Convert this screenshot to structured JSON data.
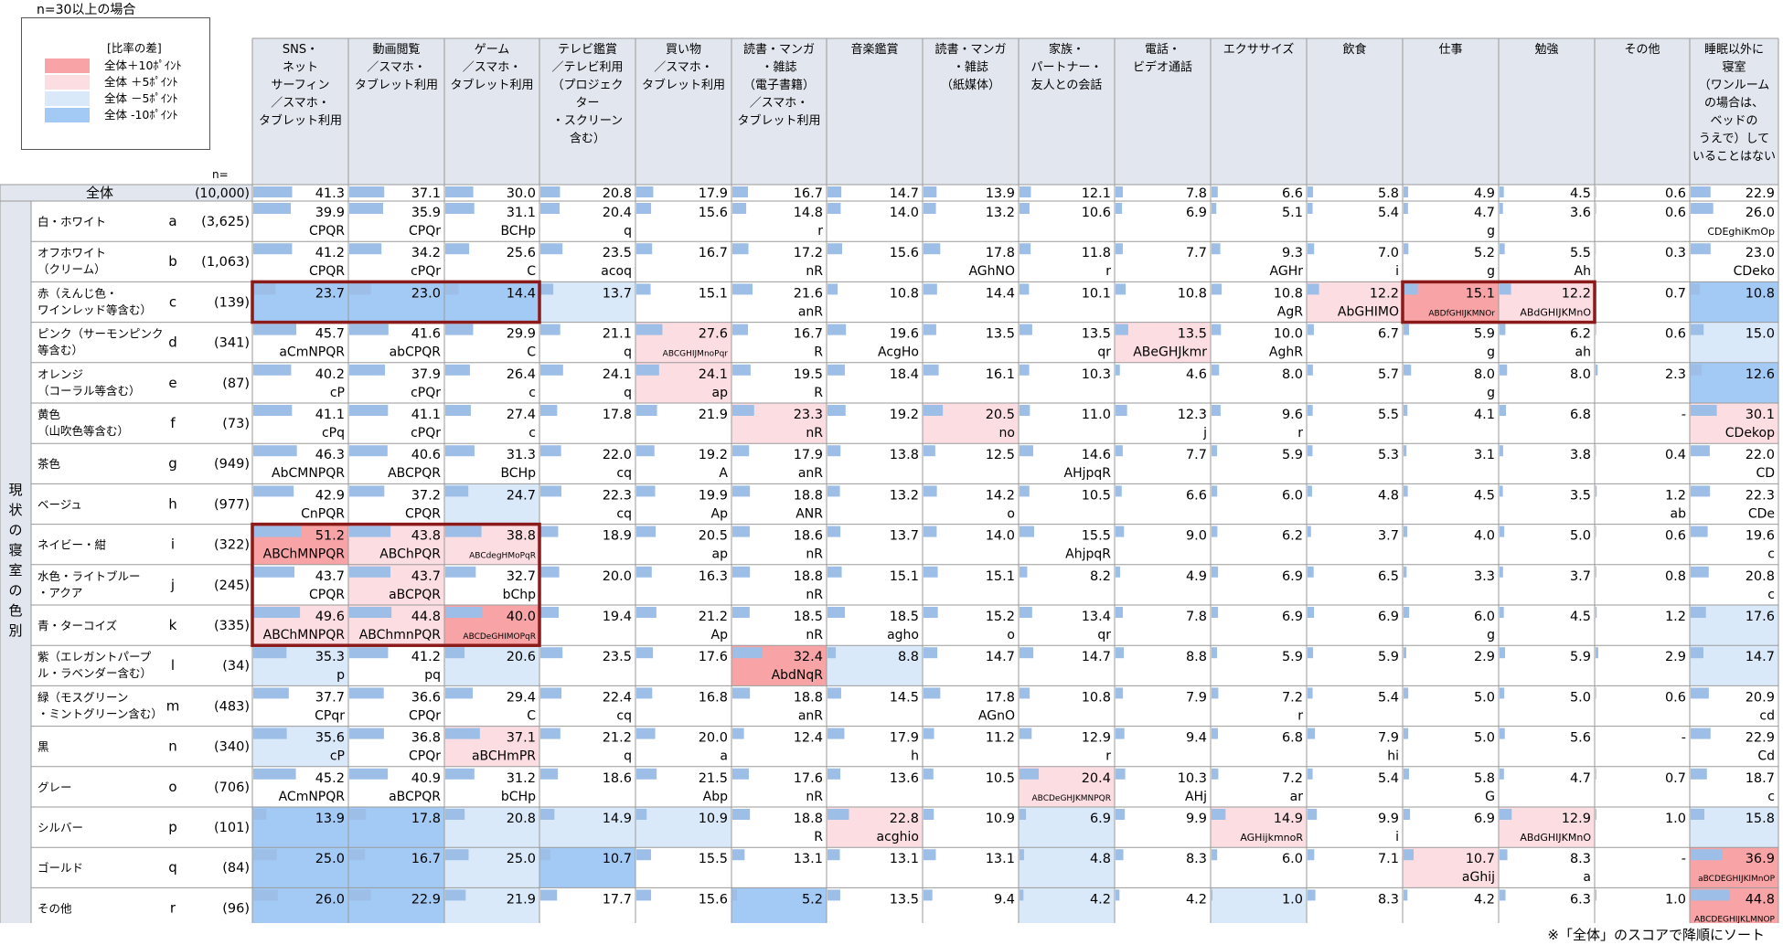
{
  "note": "n=30以上の場合",
  "unit": "(%)",
  "footer": "※「全体」のスコアで降順にソート",
  "n_label": "n=",
  "legend": {
    "title": "[比率の差]",
    "items": [
      {
        "label": "全体＋10ﾎﾟｲﾝﾄ",
        "color": "#F8A4A6"
      },
      {
        "label": "全体 ＋5ﾎﾟｲﾝﾄ",
        "color": "#FCDDE2"
      },
      {
        "label": "全体 －5ﾎﾟｲﾝﾄ",
        "color": "#DAE9FA"
      },
      {
        "label": "全体 -10ﾎﾟｲﾝﾄ",
        "color": "#A3CAF5"
      }
    ]
  },
  "colors": {
    "bar": "#9DBEE6",
    "highlight_box": "#8B1A1A",
    "grid": "#9A9A9A",
    "band": "#E2E6EE"
  },
  "chart_data": {
    "type": "table",
    "columns": [
      "SNS・\nネット\nサーフィン\n／スマホ・\nタブレット利用",
      "動画閲覧\n／スマホ・\nタブレット利用",
      "ゲーム\n／スマホ・\nタブレット利用",
      "テレビ鑑賞\n／テレビ利用\n（プロジェク\nター\n・スクリーン\n含む）",
      "買い物\n／スマホ・\nタブレット利用",
      "読書・マンガ\n・雑誌\n（電子書籍）\n／スマホ・\nタブレット利用",
      "音楽鑑賞",
      "読書・マンガ\n・雑誌\n（紙媒体）",
      "家族・\nパートナー・\n友人との会話",
      "電話・\nビデオ通話",
      "エクササイズ",
      "飲食",
      "仕事",
      "勉強",
      "その他",
      "睡眠以外に\n寝室\n（ワンルーム\nの場合は、\nベッドの\nうえで）して\nいることはない"
    ],
    "side_label": "現状の寝室の色別",
    "total": {
      "label": "全体",
      "n": "(10,000)",
      "values": [
        41.3,
        37.1,
        30.0,
        20.8,
        17.9,
        16.7,
        14.7,
        13.9,
        12.1,
        7.8,
        6.6,
        5.8,
        4.9,
        4.5,
        0.6,
        22.9
      ]
    },
    "rows": [
      {
        "label": "白・ホワイト",
        "code": "a",
        "n": "(3,625)",
        "values": [
          "39.9",
          "35.9",
          "31.1",
          "20.4",
          "15.6",
          "14.8",
          "14.0",
          "13.2",
          "10.6",
          "6.9",
          "5.1",
          "5.4",
          "4.7",
          "3.6",
          "0.6",
          "26.0"
        ],
        "sig": [
          "CPQR",
          "CPQr",
          "BCHp",
          "q",
          "",
          "r",
          "",
          "",
          "",
          "",
          "",
          "",
          "g",
          "",
          "",
          "CDEghiKmOp"
        ],
        "shade": [
          "",
          "",
          "",
          "",
          "",
          "",
          "",
          "",
          "",
          "",
          "",
          "",
          "",
          "",
          "",
          ""
        ]
      },
      {
        "label": "オフホワイト\n（クリーム）",
        "code": "b",
        "n": "(1,063)",
        "values": [
          "41.2",
          "34.2",
          "25.6",
          "23.5",
          "16.7",
          "17.2",
          "15.6",
          "17.8",
          "11.8",
          "7.7",
          "9.3",
          "7.0",
          "5.2",
          "5.5",
          "0.3",
          "23.0"
        ],
        "sig": [
          "CPQR",
          "cPQr",
          "C",
          "acoq",
          "",
          "nR",
          "",
          "AGhNO",
          "r",
          "",
          "AGHr",
          "i",
          "g",
          "Ah",
          "",
          "CDeko"
        ],
        "shade": [
          "",
          "",
          "",
          "",
          "",
          "",
          "",
          "",
          "",
          "",
          "",
          "",
          "",
          "",
          "",
          ""
        ]
      },
      {
        "label": "赤（えんじ色・\nワインレッド等含む）",
        "code": "c",
        "n": "(139)",
        "values": [
          "23.7",
          "23.0",
          "14.4",
          "13.7",
          "15.1",
          "21.6",
          "10.8",
          "14.4",
          "10.1",
          "10.8",
          "10.8",
          "12.2",
          "15.1",
          "12.2",
          "0.7",
          "10.8"
        ],
        "sig": [
          "",
          "",
          "",
          "",
          "",
          "anR",
          "",
          "",
          "",
          "",
          "AgR",
          "AbGHIMO",
          "ABDfGHIJKMNOr",
          "ABdGHIJKMnO",
          "",
          ""
        ],
        "shade": [
          "d10",
          "d10",
          "d10",
          "d5",
          "",
          "",
          "",
          "",
          "",
          "",
          "",
          "u5",
          "u10",
          "u5",
          "",
          "d10"
        ]
      },
      {
        "label": "ピンク（サーモンピンク\n等含む）",
        "code": "d",
        "n": "(341)",
        "values": [
          "45.7",
          "41.6",
          "29.9",
          "21.1",
          "27.6",
          "16.7",
          "19.6",
          "13.5",
          "13.5",
          "13.5",
          "10.0",
          "6.7",
          "5.9",
          "6.2",
          "0.6",
          "15.0"
        ],
        "sig": [
          "aCmNPQR",
          "abCPQR",
          "C",
          "q",
          "ABCGHIJMnoPqr",
          "R",
          "AcgHo",
          "",
          "qr",
          "ABeGHJkmr",
          "AghR",
          "",
          "g",
          "ah",
          "",
          ""
        ],
        "shade": [
          "",
          "",
          "",
          "",
          "u5",
          "",
          "",
          "",
          "",
          "u5",
          "",
          "",
          "",
          "",
          "",
          "d5"
        ]
      },
      {
        "label": "オレンジ\n（コーラル等含む）",
        "code": "e",
        "n": "(87)",
        "values": [
          "40.2",
          "37.9",
          "26.4",
          "24.1",
          "24.1",
          "19.5",
          "18.4",
          "16.1",
          "10.3",
          "4.6",
          "8.0",
          "5.7",
          "8.0",
          "8.0",
          "2.3",
          "12.6"
        ],
        "sig": [
          "cP",
          "cPQr",
          "c",
          "q",
          "ap",
          "R",
          "",
          "",
          "",
          "",
          "",
          "",
          "g",
          "",
          "",
          ""
        ],
        "shade": [
          "",
          "",
          "",
          "",
          "u5",
          "",
          "",
          "",
          "",
          "",
          "",
          "",
          "",
          "",
          "",
          "d10"
        ]
      },
      {
        "label": "黄色\n（山吹色等含む）",
        "code": "f",
        "n": "(73)",
        "values": [
          "41.1",
          "41.1",
          "27.4",
          "17.8",
          "21.9",
          "23.3",
          "19.2",
          "20.5",
          "11.0",
          "12.3",
          "9.6",
          "5.5",
          "4.1",
          "6.8",
          "-",
          "30.1"
        ],
        "sig": [
          "cPq",
          "cPQr",
          "c",
          "",
          "",
          "nR",
          "",
          "no",
          "",
          "j",
          "r",
          "",
          "",
          "",
          "",
          "CDekop"
        ],
        "shade": [
          "",
          "",
          "",
          "",
          "",
          "u5",
          "",
          "u5",
          "",
          "",
          "",
          "",
          "",
          "",
          "",
          "u5"
        ]
      },
      {
        "label": "茶色",
        "code": "g",
        "n": "(949)",
        "values": [
          "46.3",
          "40.6",
          "31.3",
          "22.0",
          "19.2",
          "17.9",
          "13.8",
          "12.5",
          "14.6",
          "7.7",
          "5.9",
          "5.3",
          "3.1",
          "3.8",
          "0.4",
          "22.0"
        ],
        "sig": [
          "AbCMNPQR",
          "ABCPQR",
          "BCHp",
          "cq",
          "A",
          "anR",
          "",
          "",
          "AHjpqR",
          "",
          "",
          "",
          "",
          "",
          "",
          "CD"
        ],
        "shade": [
          "",
          "",
          "",
          "",
          "",
          "",
          "",
          "",
          "",
          "",
          "",
          "",
          "",
          "",
          "",
          ""
        ]
      },
      {
        "label": "ベージュ",
        "code": "h",
        "n": "(977)",
        "values": [
          "42.9",
          "37.2",
          "24.7",
          "22.3",
          "19.9",
          "18.8",
          "13.2",
          "14.2",
          "10.5",
          "6.6",
          "6.0",
          "4.8",
          "4.5",
          "3.5",
          "1.2",
          "22.3"
        ],
        "sig": [
          "CnPQR",
          "CPQR",
          "",
          "cq",
          "Ap",
          "ANR",
          "",
          "o",
          "",
          "",
          "",
          "",
          "",
          "",
          "ab",
          "CDe"
        ],
        "shade": [
          "",
          "",
          "d5",
          "",
          "",
          "",
          "",
          "",
          "",
          "",
          "",
          "",
          "",
          "",
          "",
          ""
        ]
      },
      {
        "label": "ネイビー・紺",
        "code": "i",
        "n": "(322)",
        "values": [
          "51.2",
          "43.8",
          "38.8",
          "18.9",
          "20.5",
          "18.6",
          "13.7",
          "14.0",
          "15.5",
          "9.0",
          "6.2",
          "3.7",
          "4.0",
          "5.0",
          "0.6",
          "19.6"
        ],
        "sig": [
          "ABChMNPQR",
          "ABChPQR",
          "ABCdegHMoPqR",
          "",
          "ap",
          "nR",
          "",
          "",
          "AhjpqR",
          "",
          "",
          "",
          "",
          "",
          "",
          "c"
        ],
        "shade": [
          "u10",
          "u5",
          "u5",
          "",
          "",
          "",
          "",
          "",
          "",
          "",
          "",
          "",
          "",
          "",
          "",
          ""
        ]
      },
      {
        "label": "水色・ライトブルー\n・アクア",
        "code": "j",
        "n": "(245)",
        "values": [
          "43.7",
          "43.7",
          "32.7",
          "20.0",
          "16.3",
          "18.8",
          "15.1",
          "15.1",
          "8.2",
          "4.9",
          "6.9",
          "6.5",
          "3.3",
          "3.7",
          "0.8",
          "20.8"
        ],
        "sig": [
          "CPQR",
          "aBCPQR",
          "bChp",
          "",
          "",
          "nR",
          "",
          "",
          "",
          "",
          "",
          "",
          "",
          "",
          "",
          "c"
        ],
        "shade": [
          "",
          "u5",
          "",
          "",
          "",
          "",
          "",
          "",
          "",
          "",
          "",
          "",
          "",
          "",
          "",
          ""
        ]
      },
      {
        "label": "青・ターコイズ",
        "code": "k",
        "n": "(335)",
        "values": [
          "49.6",
          "44.8",
          "40.0",
          "19.4",
          "21.2",
          "18.5",
          "18.5",
          "15.2",
          "13.4",
          "7.8",
          "6.9",
          "6.9",
          "6.0",
          "4.5",
          "1.2",
          "17.6"
        ],
        "sig": [
          "ABChMNPQR",
          "ABChmnPQR",
          "ABCDeGHIMOPqR",
          "",
          "Ap",
          "nR",
          "agho",
          "o",
          "qr",
          "",
          "",
          "",
          "g",
          "",
          "",
          ""
        ],
        "shade": [
          "u5",
          "u5",
          "u10",
          "",
          "",
          "",
          "",
          "",
          "",
          "",
          "",
          "",
          "",
          "",
          "",
          "d5"
        ]
      },
      {
        "label": "紫（エレガントパープ\nル・ラベンダー含む）",
        "code": "l",
        "n": "(34)",
        "values": [
          "35.3",
          "41.2",
          "20.6",
          "23.5",
          "17.6",
          "32.4",
          "8.8",
          "14.7",
          "14.7",
          "8.8",
          "5.9",
          "5.9",
          "2.9",
          "5.9",
          "2.9",
          "14.7"
        ],
        "sig": [
          "p",
          "pq",
          "",
          "",
          "",
          "AbdNqR",
          "",
          "",
          "",
          "",
          "",
          "",
          "",
          "",
          "",
          ""
        ],
        "shade": [
          "d5",
          "",
          "d5",
          "",
          "",
          "u10",
          "d5",
          "",
          "",
          "",
          "",
          "",
          "",
          "",
          "",
          "d5"
        ]
      },
      {
        "label": "緑（モスグリーン\n・ミントグリーン含む）",
        "code": "m",
        "n": "(483)",
        "values": [
          "37.7",
          "36.6",
          "29.4",
          "22.4",
          "16.8",
          "18.8",
          "14.5",
          "17.8",
          "10.8",
          "7.9",
          "7.2",
          "5.4",
          "5.0",
          "5.0",
          "0.6",
          "20.9"
        ],
        "sig": [
          "CPqr",
          "CPQr",
          "C",
          "cq",
          "",
          "anR",
          "",
          "AGnO",
          "",
          "",
          "r",
          "",
          "",
          "",
          "",
          "cd"
        ],
        "shade": [
          "",
          "",
          "",
          "",
          "",
          "",
          "",
          "",
          "",
          "",
          "",
          "",
          "",
          "",
          "",
          ""
        ]
      },
      {
        "label": "黒",
        "code": "n",
        "n": "(340)",
        "values": [
          "35.6",
          "36.8",
          "37.1",
          "21.2",
          "20.0",
          "12.4",
          "17.9",
          "11.2",
          "12.9",
          "9.4",
          "6.8",
          "7.9",
          "5.0",
          "5.6",
          "-",
          "22.9"
        ],
        "sig": [
          "cP",
          "CPQr",
          "aBCHmPR",
          "q",
          "a",
          "",
          "h",
          "",
          "r",
          "",
          "",
          "hi",
          "",
          "",
          "",
          "Cd"
        ],
        "shade": [
          "d5",
          "",
          "u5",
          "",
          "",
          "",
          "",
          "",
          "",
          "",
          "",
          "",
          "",
          "",
          "",
          ""
        ]
      },
      {
        "label": "グレー",
        "code": "o",
        "n": "(706)",
        "values": [
          "45.2",
          "40.9",
          "31.2",
          "18.6",
          "21.5",
          "17.6",
          "13.6",
          "10.5",
          "20.4",
          "10.3",
          "7.2",
          "5.4",
          "5.8",
          "4.7",
          "0.7",
          "18.7"
        ],
        "sig": [
          "ACmNPQR",
          "aBCPQR",
          "bCHp",
          "",
          "Abp",
          "nR",
          "",
          "",
          "ABCDeGHJKMNPQR",
          "AHj",
          "ar",
          "",
          "G",
          "",
          "",
          "c"
        ],
        "shade": [
          "",
          "",
          "",
          "",
          "",
          "",
          "",
          "",
          "u5",
          "",
          "",
          "",
          "",
          "",
          "",
          ""
        ]
      },
      {
        "label": "シルバー",
        "code": "p",
        "n": "(101)",
        "values": [
          "13.9",
          "17.8",
          "20.8",
          "14.9",
          "10.9",
          "18.8",
          "22.8",
          "10.9",
          "6.9",
          "9.9",
          "14.9",
          "9.9",
          "6.9",
          "12.9",
          "1.0",
          "15.8"
        ],
        "sig": [
          "",
          "",
          "",
          "",
          "",
          "R",
          "acghio",
          "",
          "",
          "",
          "AGHijkmnoR",
          "i",
          "",
          "ABdGHIJKMnO",
          "",
          ""
        ],
        "shade": [
          "d10",
          "d10",
          "d5",
          "d5",
          "d5",
          "",
          "u5",
          "",
          "d5",
          "",
          "u5",
          "",
          "",
          "u5",
          "",
          "d5"
        ]
      },
      {
        "label": "ゴールド",
        "code": "q",
        "n": "(84)",
        "values": [
          "25.0",
          "16.7",
          "25.0",
          "10.7",
          "15.5",
          "13.1",
          "13.1",
          "13.1",
          "4.8",
          "8.3",
          "6.0",
          "7.1",
          "10.7",
          "8.3",
          "-",
          "36.9"
        ],
        "sig": [
          "",
          "",
          "",
          "",
          "",
          "",
          "",
          "",
          "",
          "",
          "",
          "",
          "aGhij",
          "a",
          "",
          "aBCDEGHIJKlMnOP"
        ],
        "shade": [
          "d10",
          "d10",
          "d5",
          "d10",
          "",
          "",
          "",
          "",
          "d5",
          "",
          "",
          "",
          "u5",
          "",
          "",
          "u10"
        ]
      },
      {
        "label": "その他",
        "code": "r",
        "n": "(96)",
        "values": [
          "26.0",
          "22.9",
          "21.9",
          "17.7",
          "15.6",
          "5.2",
          "13.5",
          "9.4",
          "4.2",
          "4.2",
          "1.0",
          "8.3",
          "4.2",
          "6.3",
          "1.0",
          "44.8"
        ],
        "sig": [
          "",
          "",
          "",
          "",
          "",
          "",
          "",
          "",
          "",
          "",
          "",
          "",
          "",
          "",
          "",
          "ABCDEGHIJKLMNOP"
        ],
        "shade": [
          "d10",
          "d10",
          "d5",
          "",
          "",
          "d10",
          "",
          "",
          "d5",
          "",
          "d5",
          "",
          "",
          "",
          "",
          "u10"
        ]
      }
    ],
    "highlights": [
      {
        "row_from": 0,
        "row_to": 0,
        "col_from": 0,
        "col_to": 2
      },
      {
        "row_from": 0,
        "row_to": 0,
        "col_from": 12,
        "col_to": 13
      },
      {
        "row_from": 8,
        "row_to": 10,
        "col_from": 0,
        "col_to": 2
      }
    ]
  }
}
